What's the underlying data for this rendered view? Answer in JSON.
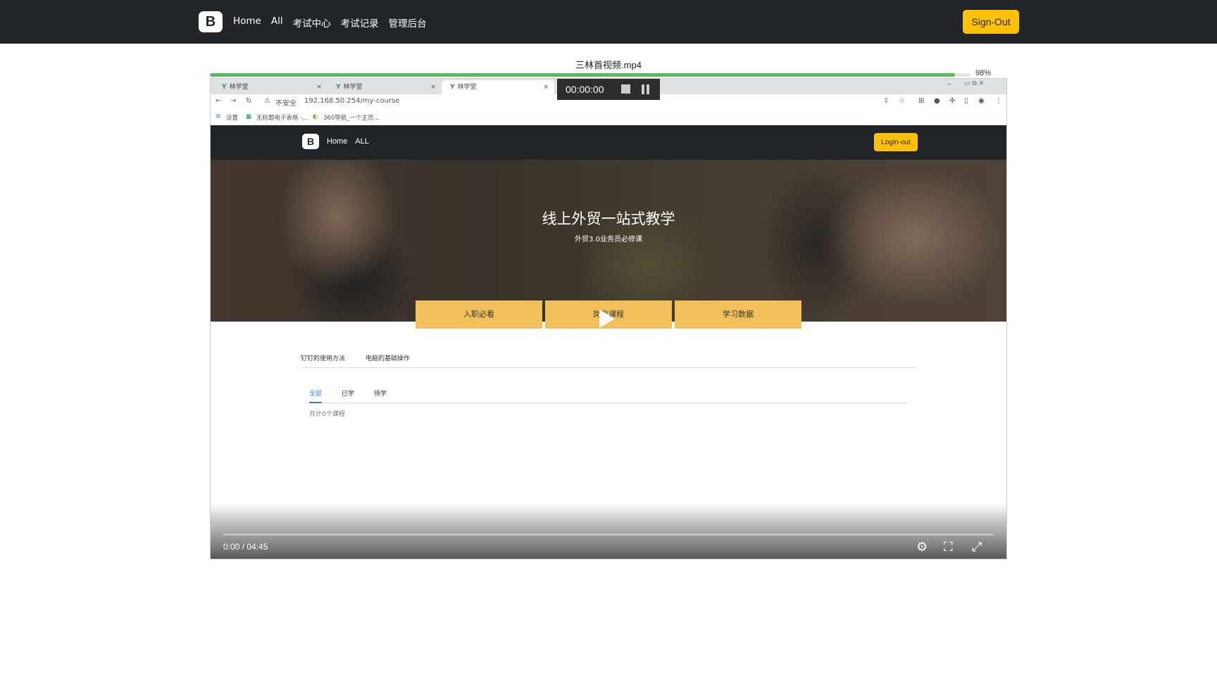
{
  "navbar": {
    "logo": "B",
    "links": [
      "Home",
      "All",
      "考试中心",
      "考试记录",
      "管理后台"
    ],
    "sign_out": "Sign-Out"
  },
  "file": {
    "title": "三林首视频.mp4",
    "progress_percent": 98,
    "progress_label": "98%"
  },
  "video": {
    "browser": {
      "tabs": [
        {
          "label": "林学堂",
          "close": "×"
        },
        {
          "label": "林学堂",
          "close": "×"
        },
        {
          "label": "林学堂",
          "close": "×"
        }
      ],
      "address_security": "不安全",
      "address_url": "192.168.50.254/my-course",
      "bookmarks": [
        "设置",
        "无标题电子表格 -...",
        "360导航_一个主页..."
      ]
    },
    "recorder": {
      "time": "00:00:00"
    },
    "inner_site": {
      "logo": "B",
      "links": [
        "Home",
        "ALL"
      ],
      "sign_out": "Login-out",
      "hero_title": "线上外贸一站式教学",
      "hero_subtitle": "外贸3.0业务员必修课",
      "hero_buttons": [
        "入职必看",
        "岗位课程",
        "学习数据"
      ],
      "course_tabs": [
        "钉钉的使用方法",
        "电脑的基础操作"
      ],
      "filter_tabs": [
        "全部",
        "已学",
        "待学"
      ],
      "course_count": "共计0个课程"
    },
    "controls": {
      "time": "0:00 / 04:45"
    }
  }
}
